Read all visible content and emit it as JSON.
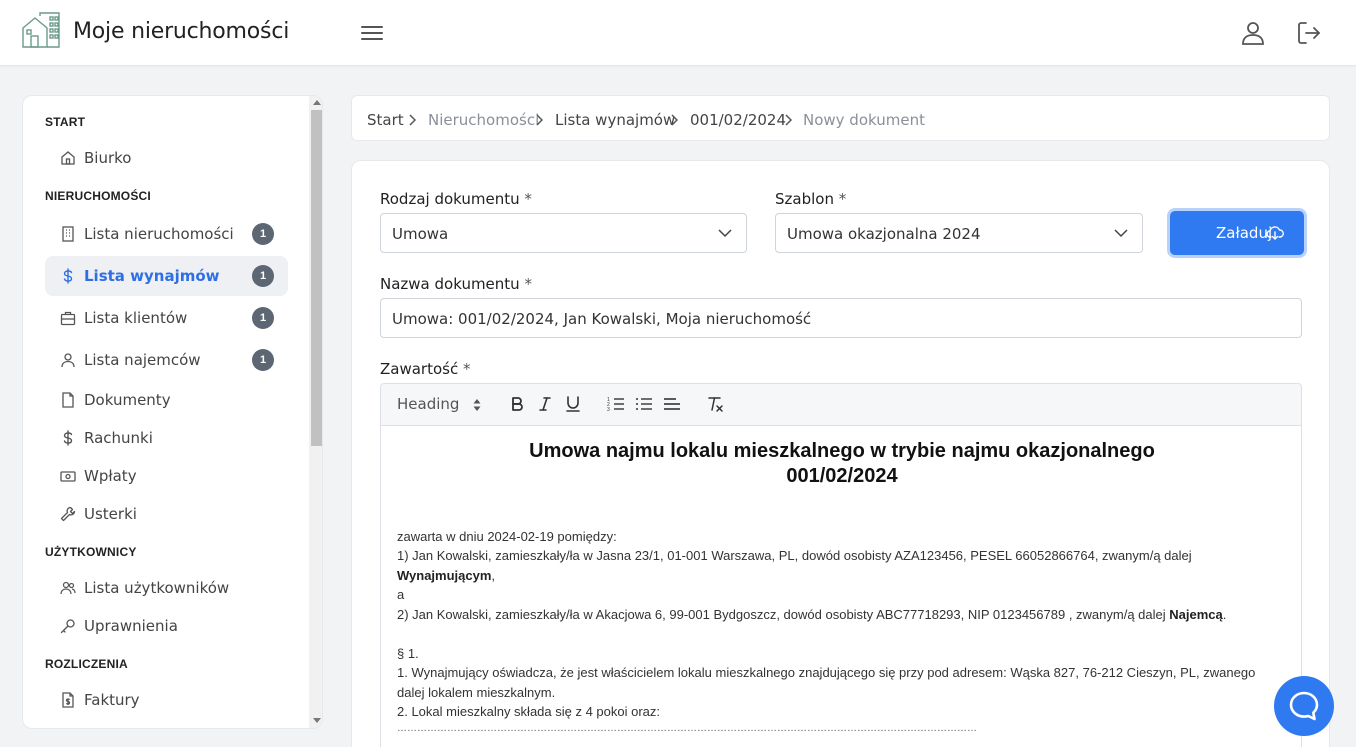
{
  "header": {
    "app_title": "Moje nieruchomości",
    "icons": {
      "logo": "building-logo-icon",
      "menu": "hamburger-icon",
      "user": "user-icon",
      "logout": "logout-icon"
    }
  },
  "sidebar": {
    "sections": [
      {
        "title": "START"
      },
      {
        "title": "NIERUCHOMOŚCI"
      },
      {
        "title": "UŻYTKOWNICY"
      },
      {
        "title": "ROZLICZENIA"
      }
    ],
    "items": [
      {
        "label": "Biurko",
        "icon": "home-icon"
      },
      {
        "label": "Lista nieruchomości",
        "icon": "building-icon",
        "badge": "1"
      },
      {
        "label": "Lista wynajmów",
        "icon": "dollar-icon",
        "badge": "1",
        "active": true
      },
      {
        "label": "Lista klientów",
        "icon": "briefcase-icon",
        "badge": "1"
      },
      {
        "label": "Lista najemców",
        "icon": "person-icon",
        "badge": "1"
      },
      {
        "label": "Dokumenty",
        "icon": "file-icon"
      },
      {
        "label": "Rachunki",
        "icon": "dollar-icon"
      },
      {
        "label": "Wpłaty",
        "icon": "cash-icon"
      },
      {
        "label": "Usterki",
        "icon": "wrench-icon"
      },
      {
        "label": "Lista użytkowników",
        "icon": "people-icon"
      },
      {
        "label": "Uprawnienia",
        "icon": "key-icon"
      },
      {
        "label": "Faktury",
        "icon": "invoice-icon"
      }
    ]
  },
  "breadcrumb": [
    "Start",
    "Nieruchomości",
    "Lista wynajmów",
    "001/02/2024",
    "Nowy dokument"
  ],
  "form": {
    "doc_type_label": "Rodzaj dokumentu",
    "doc_type_value": "Umowa",
    "template_label": "Szablon",
    "template_value": "Umowa okazjonalna 2024",
    "load_button": "Załaduj",
    "name_label": "Nazwa dokumentu",
    "name_value": "Umowa: 001/02/2024, Jan Kowalski, Moja nieruchomość",
    "content_label": "Zawartość",
    "required_mark": "*"
  },
  "editor": {
    "heading_select": "Heading",
    "toolbar_icons": [
      "bold-icon",
      "italic-icon",
      "underline-icon",
      "ordered-list-icon",
      "bullet-list-icon",
      "align-icon",
      "clear-format-icon"
    ],
    "title_line1": "Umowa najmu lokalu mieszkalnego w trybie najmu okazjonalnego",
    "title_line2": "001/02/2024",
    "lines": {
      "l1": "zawarta w dniu 2024-02-19 pomiędzy:",
      "l2": "1) Jan Kowalski, zamieszkały/ła w Jasna 23/1, 01-001 Warszawa, PL, dowód osobisty AZA123456, PESEL 66052866764, zwanym/ą dalej",
      "l3_bold": "Wynajmującym",
      "l3_rest": ",",
      "l4": "a",
      "l5": "2) Jan Kowalski, zamieszkały/ła w Akacjowa 6, 99-001 Bydgoszcz, dowód osobisty ABC77718293, NIP 0123456789 , zwanym/ą dalej ",
      "l5_bold": "Najemcą",
      "l5_end": ".",
      "l6": "§ 1.",
      "l7": "1. Wynajmujący oświadcza, że jest właścicielem lokalu mieszkalnego znajdującego się przy pod adresem: Wąska 827, 76-212 Cieszyn, PL, zwanego",
      "l8": "dalej lokalem mieszkalnym.",
      "l9": "2. Lokal mieszkalny składa się z 4 pokoi oraz:",
      "l10": "…………………………………………………………………………………………………………………………………………………………"
    }
  },
  "chat": {
    "icon": "chat-bubble-icon"
  }
}
